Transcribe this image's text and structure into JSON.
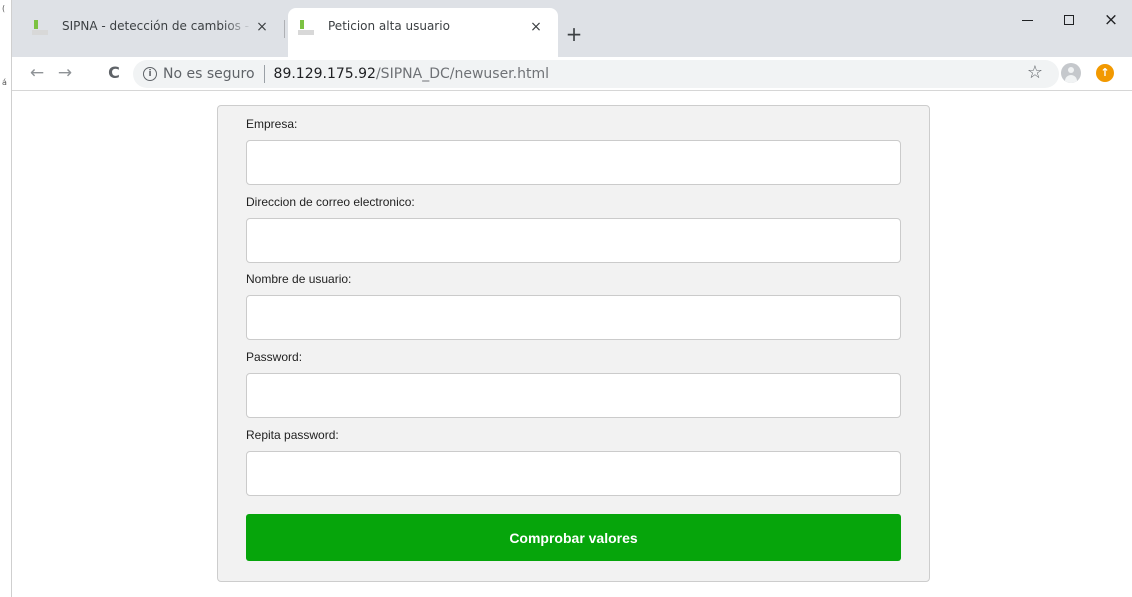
{
  "browser": {
    "tabs": [
      {
        "title": "SIPNA - detección de cambios - l",
        "close": "×"
      },
      {
        "title": "Peticion alta usuario",
        "close": "×"
      }
    ],
    "new_tab": "+",
    "window_close": "×",
    "security_icon": "ⓘ",
    "security_text": "No es seguro",
    "url_host": "89.129.175.92",
    "url_path": "/SIPNA_DC/newuser.html",
    "icons": {
      "back": "back-arrow-icon",
      "forward": "forward-arrow-icon",
      "reload": "reload-icon",
      "star": "star-icon",
      "profile": "profile-avatar-icon",
      "update": "update-icon"
    }
  },
  "form": {
    "fields": [
      {
        "label": "Empresa:",
        "value": "",
        "type": "text"
      },
      {
        "label": "Direccion de correo electronico:",
        "value": "",
        "type": "text"
      },
      {
        "label": "Nombre de usuario:",
        "value": "",
        "type": "text"
      },
      {
        "label": "Password:",
        "value": "",
        "type": "password"
      },
      {
        "label": "Repita password:",
        "value": "",
        "type": "password"
      }
    ],
    "submit_label": "Comprobar valores"
  },
  "colors": {
    "submit_button": "#06a50b",
    "card_background": "#f2f2f2",
    "tabstrip": "#dee1e6"
  }
}
